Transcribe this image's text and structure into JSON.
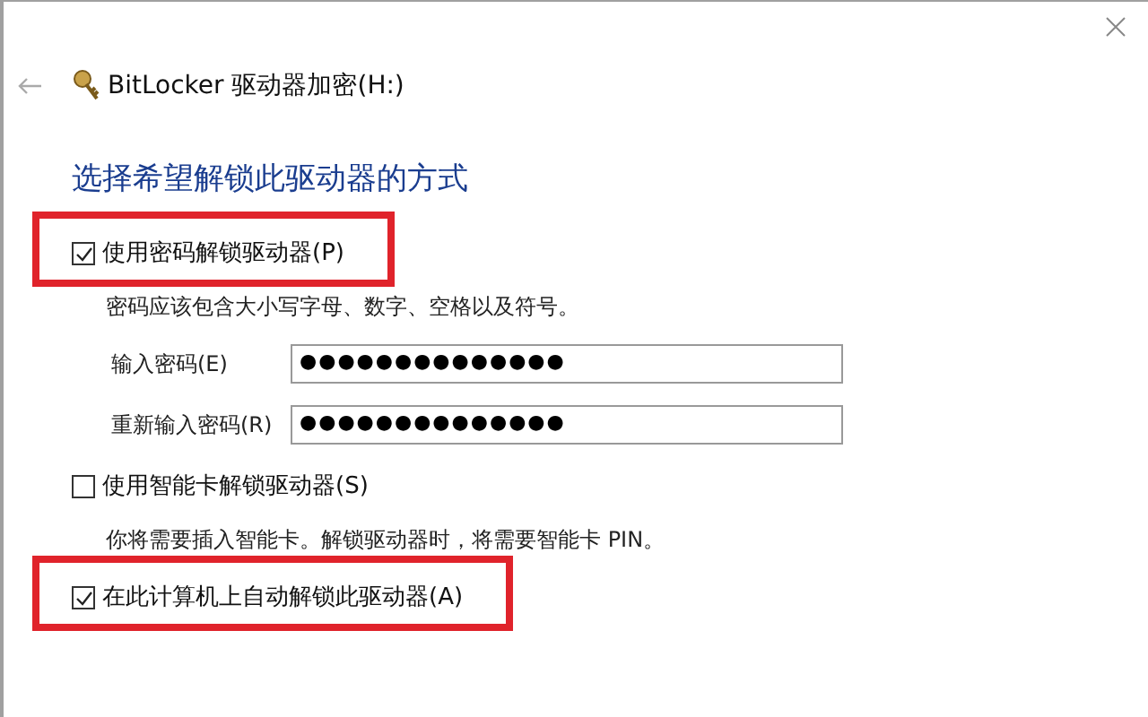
{
  "window": {
    "title": "BitLocker 驱动器加密(H:)"
  },
  "heading": "选择希望解锁此驱动器的方式",
  "options": [
    {
      "label": "使用密码解锁驱动器(P)",
      "checked": true,
      "highlighted": true,
      "description": "密码应该包含大小写字母、数字、空格以及符号。",
      "fields": [
        {
          "label": "输入密码(E)",
          "value": "●●●●●●●●●●●●●●"
        },
        {
          "label": "重新输入密码(R)",
          "value": "●●●●●●●●●●●●●●"
        }
      ]
    },
    {
      "label": "使用智能卡解锁驱动器(S)",
      "checked": false,
      "highlighted": false,
      "description": "你将需要插入智能卡。解锁驱动器时，将需要智能卡 PIN。"
    },
    {
      "label": "在此计算机上自动解锁此驱动器(A)",
      "checked": true,
      "highlighted": true
    }
  ]
}
